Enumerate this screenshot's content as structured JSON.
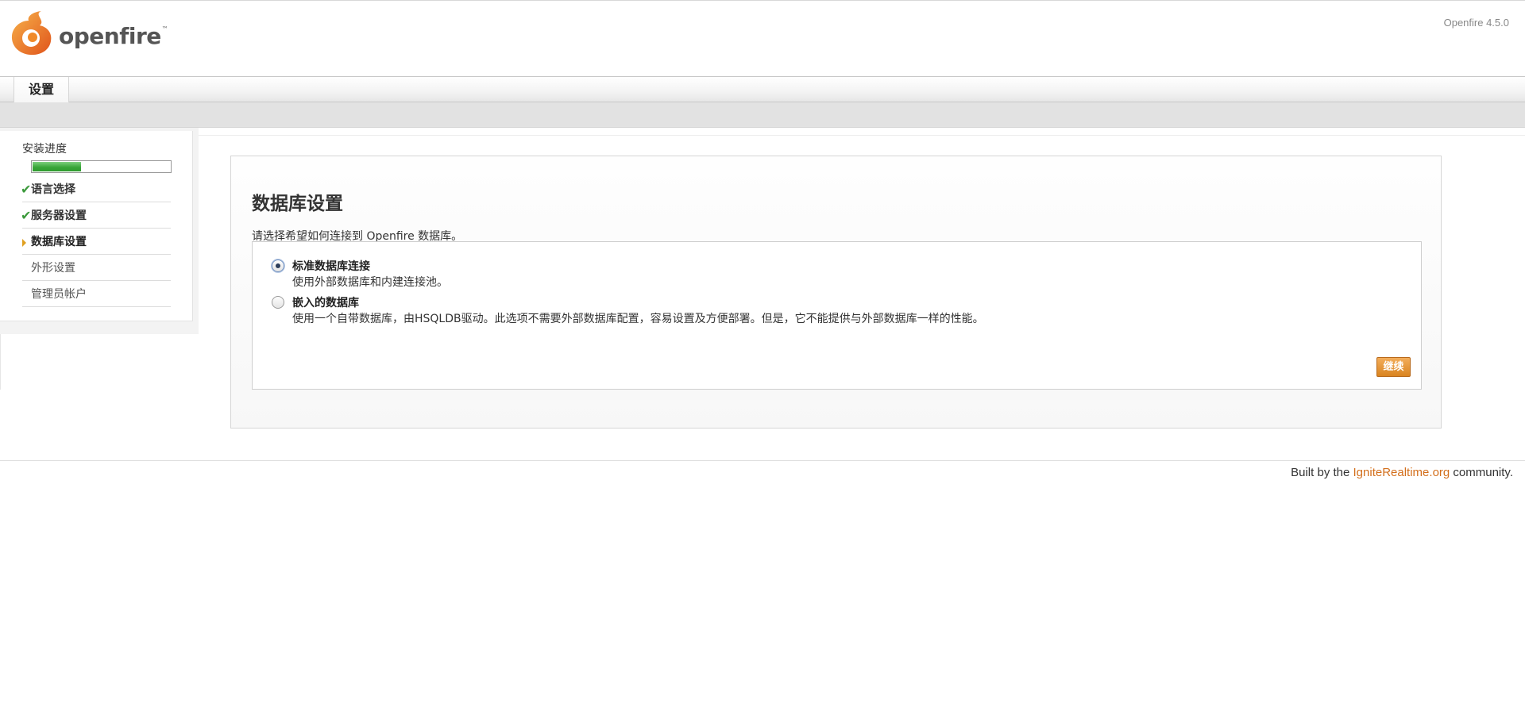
{
  "header": {
    "logo_text": "openfire",
    "logo_tm": "™",
    "version": "Openfire 4.5.0"
  },
  "tabs": [
    {
      "label": "设置"
    }
  ],
  "sidebar": {
    "progress_label": "安装进度",
    "progress_value": 0.35,
    "steps": [
      {
        "label": "语言选择",
        "state": "done"
      },
      {
        "label": "服务器设置",
        "state": "done"
      },
      {
        "label": "数据库设置",
        "state": "current"
      },
      {
        "label": "外形设置",
        "state": "pending"
      },
      {
        "label": "管理员帐户",
        "state": "pending"
      }
    ]
  },
  "main": {
    "title": "数据库设置",
    "intro": "请选择希望如何连接到 Openfire 数据库。",
    "options": [
      {
        "title": "标准数据库连接",
        "description": "使用外部数据库和内建连接池。",
        "selected": true
      },
      {
        "title": "嵌入的数据库",
        "description": "使用一个自带数据库，由HSQLDB驱动。此选项不需要外部数据库配置，容易设置及方便部署。但是，它不能提供与外部数据库一样的性能。",
        "selected": false
      }
    ],
    "continue_label": "继续"
  },
  "footer": {
    "prefix": "Built by the ",
    "link": "IgniteRealtime.org",
    "suffix": " community."
  },
  "colors": {
    "accent": "#d36f1c",
    "progress": "#3aa63a",
    "check": "#3c9a3c"
  }
}
